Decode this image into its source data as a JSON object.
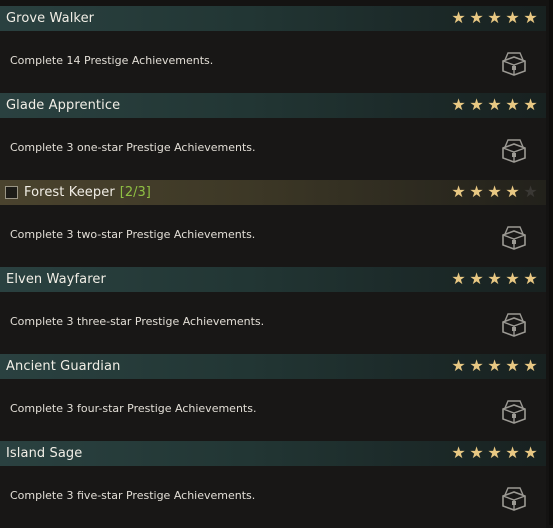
{
  "achievements": [
    {
      "title": "Grove Walker",
      "progress": "",
      "description": "Complete 14 Prestige Achievements.",
      "stars_total": 5,
      "stars_earned": 5,
      "completed": true
    },
    {
      "title": "Glade Apprentice",
      "progress": "",
      "description": "Complete 3 one-star Prestige Achievements.",
      "stars_total": 5,
      "stars_earned": 5,
      "completed": true
    },
    {
      "title": "Forest Keeper",
      "progress": "[2/3]",
      "description": "Complete 3 two-star Prestige Achievements.",
      "stars_total": 5,
      "stars_earned": 4,
      "completed": false
    },
    {
      "title": "Elven Wayfarer",
      "progress": "",
      "description": "Complete 3 three-star Prestige Achievements.",
      "stars_total": 5,
      "stars_earned": 5,
      "completed": true
    },
    {
      "title": "Ancient Guardian",
      "progress": "",
      "description": "Complete 3 four-star Prestige Achievements.",
      "stars_total": 5,
      "stars_earned": 5,
      "completed": true
    },
    {
      "title": "Island Sage",
      "progress": "",
      "description": "Complete 3 five-star Prestige Achievements.",
      "stars_total": 5,
      "stars_earned": 5,
      "completed": true
    }
  ],
  "icons": {
    "star": "star-icon",
    "reward": "reward-chest-icon",
    "checkbox": "tracking-checkbox"
  },
  "colors": {
    "header_completed": "#2a4140",
    "header_in_progress": "#4a432e",
    "star_earned": "#e8c883",
    "star_empty": "#3a3834",
    "progress_text": "#8fc043"
  }
}
